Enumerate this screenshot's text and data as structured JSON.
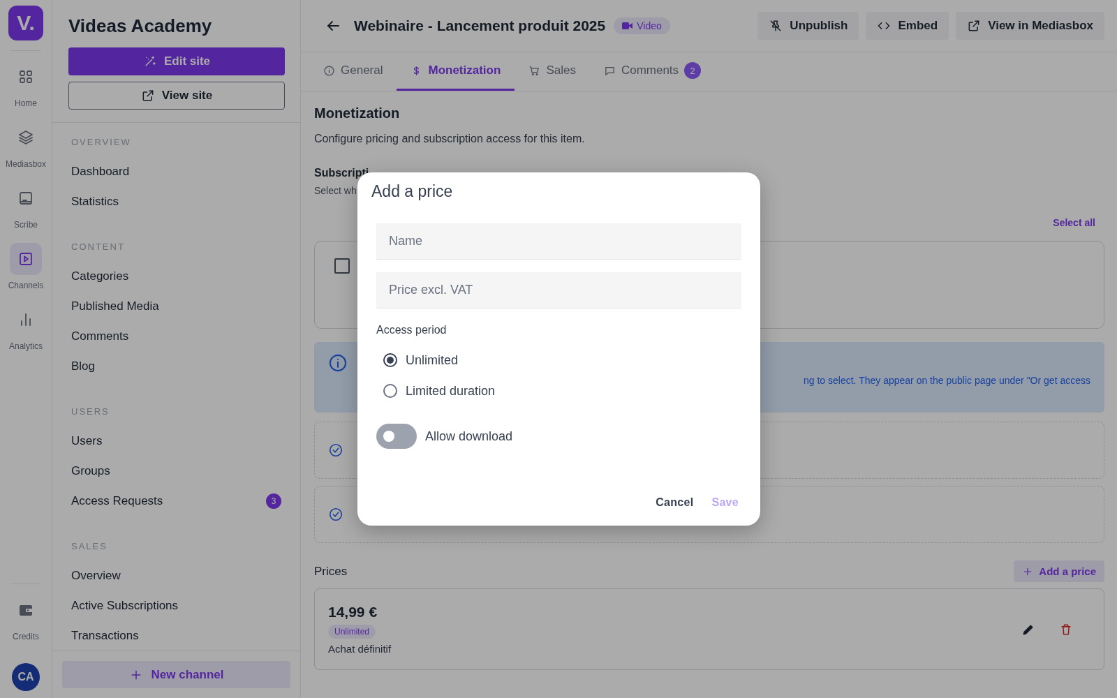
{
  "rail": {
    "logo": "V.",
    "items": [
      {
        "label": "Home",
        "selected": false
      },
      {
        "label": "Mediasbox",
        "selected": false
      },
      {
        "label": "Scribe",
        "selected": false
      },
      {
        "label": "Channels",
        "selected": true
      },
      {
        "label": "Analytics",
        "selected": false
      }
    ],
    "credits": "Credits",
    "avatar": "CA"
  },
  "sidebar": {
    "title": "Videas Academy",
    "edit_button": "Edit site",
    "view_button": "View site",
    "sections": [
      {
        "heading": "OVERVIEW",
        "items": [
          {
            "label": "Dashboard"
          },
          {
            "label": "Statistics"
          }
        ]
      },
      {
        "heading": "CONTENT",
        "items": [
          {
            "label": "Categories"
          },
          {
            "label": "Published Media"
          },
          {
            "label": "Comments"
          },
          {
            "label": "Blog"
          }
        ]
      },
      {
        "heading": "USERS",
        "items": [
          {
            "label": "Users"
          },
          {
            "label": "Groups"
          },
          {
            "label": "Access Requests",
            "badge": "3"
          }
        ]
      },
      {
        "heading": "SALES",
        "items": [
          {
            "label": "Overview"
          },
          {
            "label": "Active Subscriptions"
          },
          {
            "label": "Transactions"
          }
        ]
      }
    ],
    "new_channel": "New channel"
  },
  "header": {
    "title": "Webinaire - Lancement produit 2025",
    "badge": "Video",
    "actions": [
      "Unpublish",
      "Embed",
      "View in Mediasbox"
    ]
  },
  "tabs": [
    {
      "label": "General",
      "selected": false
    },
    {
      "label": "Monetization",
      "selected": true
    },
    {
      "label": "Sales",
      "selected": false
    },
    {
      "label": "Comments",
      "selected": false,
      "count": "2"
    }
  ],
  "monetization": {
    "title": "Monetization",
    "description": "Configure pricing and subscription access for this item.",
    "subscriptions": {
      "title": "Subscripti",
      "hint": "Select wh",
      "select_all": "Select all",
      "checked": false
    },
    "info_text": "ng to select. They appear on the public page under \"Or get access",
    "plans": [
      {
        "checked": true
      },
      {
        "checked": true
      }
    ],
    "prices": {
      "title": "Prices",
      "add_button": "Add a price",
      "items": [
        {
          "amount": "14,99 €",
          "tag": "Unlimited",
          "description": "Achat définitif"
        }
      ]
    }
  },
  "modal": {
    "title": "Add a price",
    "fields": [
      {
        "placeholder": "Name"
      },
      {
        "placeholder": "Price excl. VAT"
      }
    ],
    "access_label": "Access period",
    "options": [
      {
        "label": "Unlimited",
        "selected": true
      },
      {
        "label": "Limited duration",
        "selected": false
      }
    ],
    "toggle": {
      "label": "Allow download",
      "on": false
    },
    "cancel": "Cancel",
    "save": "Save",
    "save_disabled": true
  }
}
